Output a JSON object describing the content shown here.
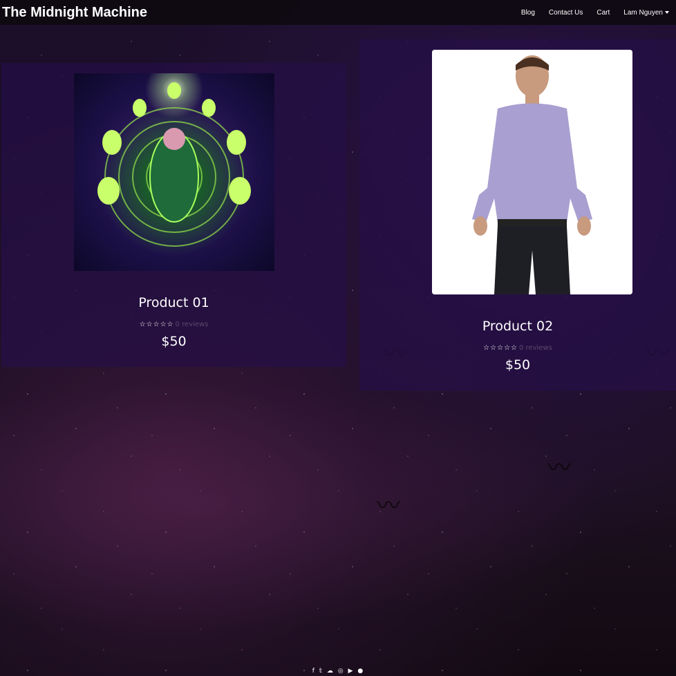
{
  "navbar": {
    "brand": "The Midnight Machine",
    "links": [
      "Blog",
      "Contact Us",
      "Cart"
    ],
    "user": "Lam Nguyen"
  },
  "products": [
    {
      "title": "Product 01",
      "rating": 0,
      "reviews_label": "0 reviews",
      "price": "$50",
      "image": "psychedelic-deity-art"
    },
    {
      "title": "Product 02",
      "rating": 0,
      "reviews_label": "0 reviews",
      "price": "$50",
      "image": "man-in-plaid-shirt"
    }
  ],
  "footer": {
    "icons": [
      "facebook-icon",
      "twitter-icon",
      "soundcloud-icon",
      "instagram-icon",
      "youtube-icon",
      "spotify-icon"
    ]
  },
  "colors": {
    "navbar_bg": "#0e0a10",
    "card_bg": "#260f46",
    "reviews_text": "#5a4a6a"
  }
}
